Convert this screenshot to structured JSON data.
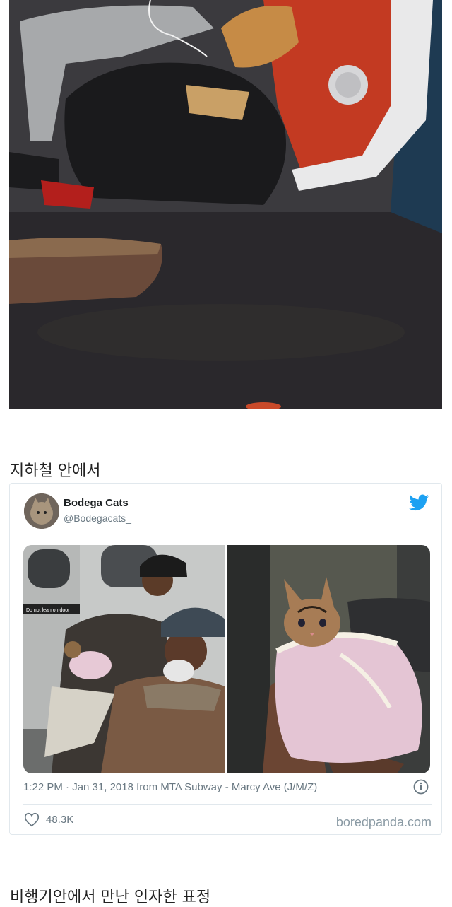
{
  "captions": {
    "subway": "지하철 안에서",
    "airplane": "비행기안에서 만난 인자한 표정"
  },
  "tweet": {
    "name": "Bodega Cats",
    "handle": "@Bodegacats_",
    "sign_text": "Do not lean on door",
    "meta": "1:22 PM · Jan 31, 2018 from MTA Subway - Marcy Ave (J/M/Z)",
    "likes": "48.3K",
    "source": "boredpanda.com"
  },
  "icons": {
    "bird": "twitter-bird-icon",
    "info": "info-icon",
    "like": "heart-icon"
  },
  "colors": {
    "twitter_blue": "#1da1f2",
    "meta_gray": "#697882",
    "border": "#e1e8ed"
  }
}
